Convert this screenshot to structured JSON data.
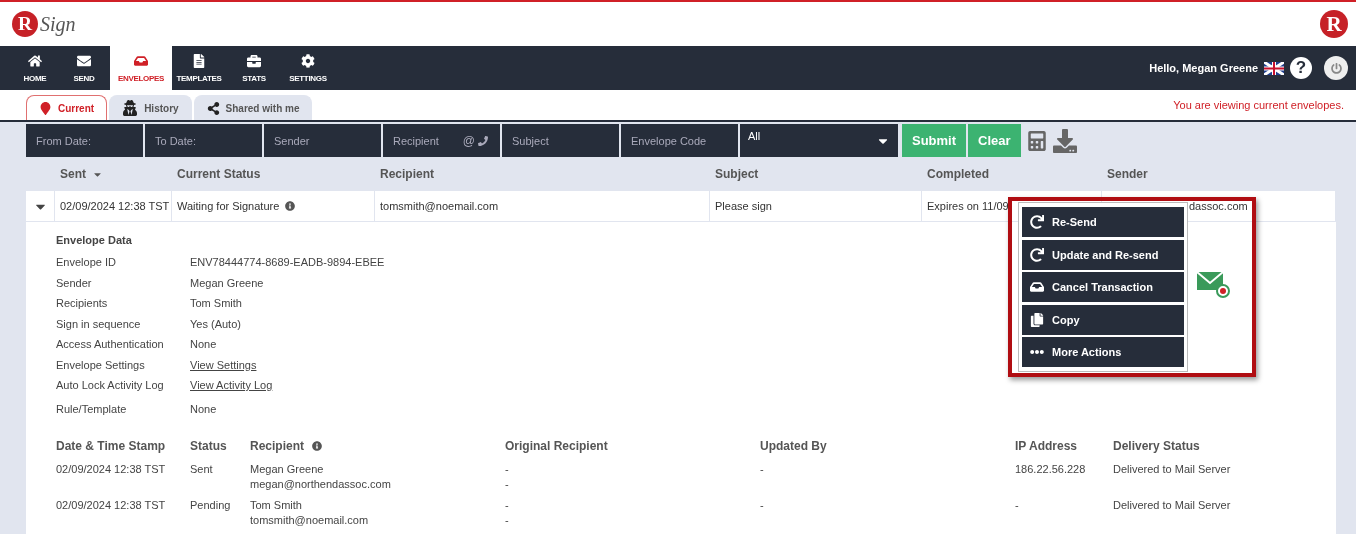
{
  "logo": {
    "letter": "R",
    "word": "Sign"
  },
  "logo_right": {
    "letter": "R"
  },
  "nav": {
    "items": [
      {
        "label": "HOME",
        "selected": false
      },
      {
        "label": "SEND",
        "selected": false
      },
      {
        "label": "ENVELOPES",
        "selected": true
      },
      {
        "label": "TEMPLATES",
        "selected": false
      },
      {
        "label": "STATS",
        "selected": false
      },
      {
        "label": "SETTINGS",
        "selected": false
      }
    ],
    "greeting": "Hello, Megan Greene",
    "help": "?"
  },
  "tabs": [
    {
      "label": "Current",
      "selected": true
    },
    {
      "label": "History",
      "selected": false
    },
    {
      "label": "Shared with me",
      "selected": false
    }
  ],
  "notice": "You are viewing current envelopes.",
  "filters": {
    "fields": [
      {
        "placeholder": "From Date:"
      },
      {
        "placeholder": "To Date:"
      },
      {
        "placeholder": "Sender"
      },
      {
        "placeholder": "Recipient",
        "at_sign": "@"
      },
      {
        "placeholder": "Subject"
      },
      {
        "placeholder": "Envelope Code"
      }
    ],
    "select": "All",
    "buttons": [
      "Submit",
      "Clear"
    ]
  },
  "table": {
    "columns": [
      {
        "label": "Sent",
        "sorted": true
      },
      {
        "label": "Current Status",
        "sorted": false
      },
      {
        "label": "Recipient",
        "sorted": false
      },
      {
        "label": "Subject",
        "sorted": false
      },
      {
        "label": "Completed",
        "sorted": false
      },
      {
        "label": "Sender",
        "sorted": false
      }
    ],
    "row": {
      "expanded": true,
      "sent": "02/09/2024 12:38 TST",
      "status": "Waiting for Signature",
      "recipient": "tomsmith@noemail.com",
      "subject": "Please sign",
      "completed": "Expires on 11/09",
      "sender": "dassoc.com"
    }
  },
  "envelope_data": {
    "title": "Envelope Data",
    "fields": [
      {
        "label": "Envelope ID",
        "value": "ENV78444774-8689-EADB-9894-EBEE",
        "kind": "text"
      },
      {
        "label": "Sender",
        "value": "Megan Greene",
        "kind": "text"
      },
      {
        "label": "Recipients",
        "value": "Tom Smith",
        "kind": "text"
      },
      {
        "label": "Sign in sequence",
        "value": "Yes (Auto)",
        "kind": "text"
      },
      {
        "label": "Access Authentication",
        "value": "None",
        "kind": "text"
      },
      {
        "label": "Envelope Settings",
        "value": "View Settings",
        "kind": "link"
      },
      {
        "label": "Auto Lock Activity Log",
        "value": "View Activity Log",
        "kind": "link"
      },
      {
        "label": "Rule/Template",
        "value": "None",
        "kind": "text"
      }
    ]
  },
  "history": {
    "columns": [
      "Date & Time Stamp",
      "Status",
      "Recipient",
      "Original Recipient",
      "Updated By",
      "IP Address",
      "Delivery Status"
    ],
    "rows": [
      {
        "date": "02/09/2024 12:38 TST",
        "status": "Sent",
        "recipient_name": "Megan Greene",
        "recipient_email": "megan@northendassoc.com",
        "original": [
          "-",
          "-"
        ],
        "updated_by": "-",
        "ip": "186.22.56.228",
        "delivery": "Delivered to Mail Server"
      },
      {
        "date": "02/09/2024 12:38 TST",
        "status": "Pending",
        "recipient_name": "Tom Smith",
        "recipient_email": "tomsmith@noemail.com",
        "original": [
          "-",
          "-"
        ],
        "updated_by": "-",
        "ip": "-",
        "delivery": "Delivered to Mail Server"
      }
    ]
  },
  "actions_menu": {
    "items": [
      {
        "label": "Re-Send"
      },
      {
        "label": "Update and Re-send"
      },
      {
        "label": "Cancel Transaction"
      },
      {
        "label": "Copy"
      },
      {
        "label": "More Actions"
      }
    ]
  }
}
